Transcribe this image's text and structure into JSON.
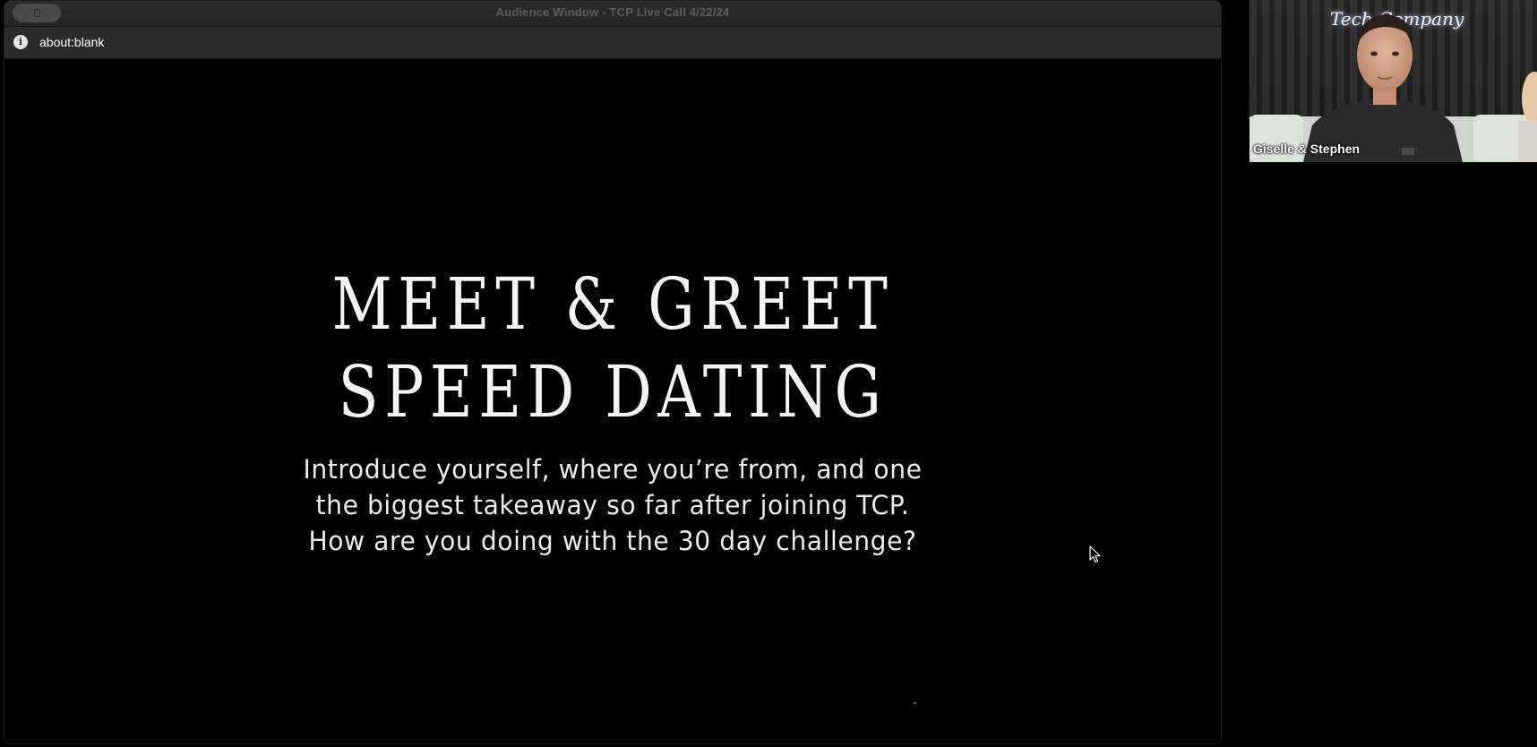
{
  "window": {
    "title": "Audience Window - TCP Live Call 4/22/24",
    "url": "about:blank",
    "info_icon": "info-circle-icon"
  },
  "slide": {
    "title_line1": "MEET & GREET",
    "title_line2": "SPEED DATING",
    "body_line1": "Introduce yourself, where you’re from, and one",
    "body_line2": "the biggest takeaway so far after joining TCP.",
    "body_line3": "How are you doing with the 30 day challenge?"
  },
  "video": {
    "participant_name": "Giselle & Stephen",
    "neon_sign": "Tech Company"
  },
  "colors": {
    "background": "#000000",
    "titlebar": "#2a2a2a",
    "addressbar": "#2b2b2b",
    "slide_text": "#f4f4f4"
  }
}
